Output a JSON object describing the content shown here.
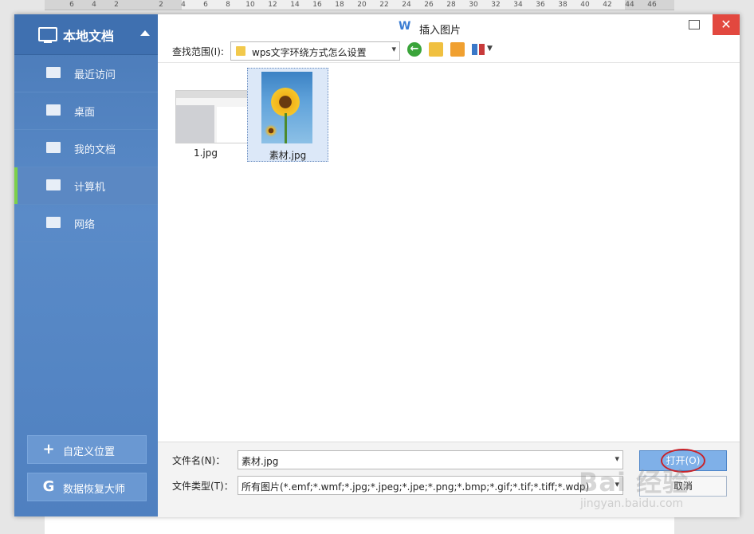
{
  "ruler": {
    "ticks": [
      "6",
      "4",
      "2",
      "2",
      "4",
      "6",
      "8",
      "10",
      "12",
      "14",
      "16",
      "18",
      "20",
      "22",
      "24",
      "26",
      "28",
      "30",
      "32",
      "34",
      "36",
      "38",
      "40",
      "42",
      "44",
      "46"
    ]
  },
  "sidebar": {
    "header_title": "本地文档",
    "items": [
      {
        "label": "最近访问",
        "icon": "recent-folder-icon"
      },
      {
        "label": "桌面",
        "icon": "desktop-icon"
      },
      {
        "label": "我的文档",
        "icon": "folder-icon"
      },
      {
        "label": "计算机",
        "icon": "computer-icon",
        "active": true
      },
      {
        "label": "网络",
        "icon": "network-icon"
      }
    ],
    "custom_location_label": "自定义位置",
    "recovery_label": "数据恢复大师"
  },
  "dialog": {
    "title": "插入图片",
    "app_logo": "W"
  },
  "toolbar": {
    "lookin_label": "查找范围(I):",
    "lookin_value": "wps文字环绕方式怎么设置"
  },
  "files": [
    {
      "name": "1.jpg",
      "selected": false
    },
    {
      "name": "素材.jpg",
      "selected": true
    }
  ],
  "bottom": {
    "filename_label": "文件名(N)：",
    "filename_value": "素材.jpg",
    "filetype_label": "文件类型(T)：",
    "filetype_value": "所有图片(*.emf;*.wmf;*.jpg;*.jpeg;*.jpe;*.png;*.bmp;*.gif;*.tif;*.tiff;*.wdp)",
    "open_label": "打开(O)",
    "cancel_label": "取消"
  },
  "watermark": {
    "line1": "Bai 经验",
    "line2": "jingyan.baidu.com"
  },
  "colors": {
    "sidebar_bg": "#4f80c0",
    "active_marker": "#7cd04a",
    "close_button": "#e2483f",
    "open_button": "#7fb0e8",
    "highlight_ring": "#c8232a"
  }
}
